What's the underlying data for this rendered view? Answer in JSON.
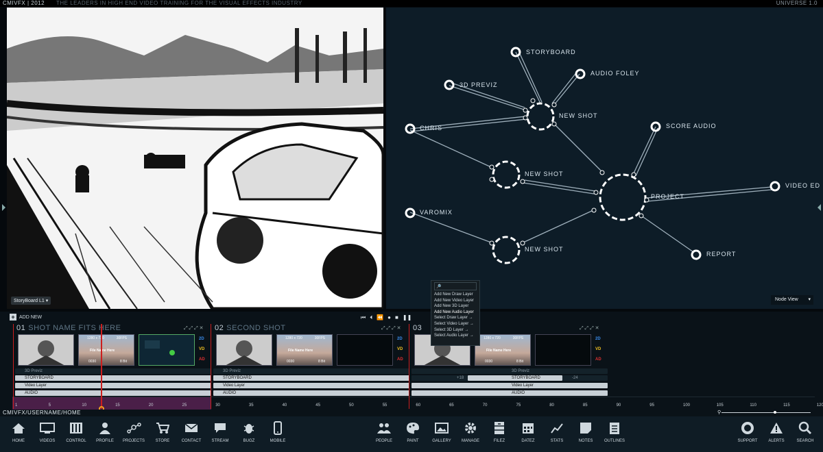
{
  "topbar": {
    "brand": "CMIVFX | 2012",
    "tagline": "THE LEADERS IN HIGH END VIDEO TRAINING FOR THE VISUAL EFFECTS INDUSTRY",
    "version": "UNIVERSE 1.0"
  },
  "viewer": {
    "label": "StoryBoard L1"
  },
  "nodeview": {
    "mode_label": "Node View",
    "nodes": [
      {
        "label": "STORYBOARD"
      },
      {
        "label": "AUDIO FOLEY"
      },
      {
        "label": "3D PREVIZ"
      },
      {
        "label": "NEW SHOT"
      },
      {
        "label": "CHRIS"
      },
      {
        "label": "SCORE AUDIO"
      },
      {
        "label": "NEW SHOT"
      },
      {
        "label": "PROJECT"
      },
      {
        "label": "VIDEO ED"
      },
      {
        "label": "VAROMIX"
      },
      {
        "label": "NEW SHOT"
      },
      {
        "label": "REPORT"
      }
    ]
  },
  "timeline": {
    "add_new": "ADD NEW",
    "shots": [
      {
        "num": "01",
        "name": "SHOT NAME FITS HERE"
      },
      {
        "num": "02",
        "name": "SECOND SHOT"
      },
      {
        "num": "03",
        "name": ""
      }
    ],
    "clip_info": {
      "res": "1280 x 720",
      "fps": "30FPS",
      "name": "File Name Here",
      "frame": "0030",
      "bits": "8 Bit"
    },
    "tags": [
      "2D",
      "VD",
      "AD"
    ],
    "layers": [
      "3D Previz",
      "STORYBOARD",
      "Video Layer",
      "AUDIO"
    ],
    "offsets": [
      "+18",
      "-24"
    ],
    "ruler": [
      "1",
      "5",
      "10",
      "15",
      "20",
      "25",
      "30",
      "35",
      "40",
      "45",
      "50",
      "55",
      "60",
      "65",
      "70",
      "75",
      "80",
      "85",
      "90",
      "95",
      "100",
      "105",
      "110",
      "115",
      "120"
    ]
  },
  "context_menu": {
    "items": [
      "Add New Draw Layer",
      "Add New Video Layer",
      "Add New 3D Layer",
      "Add New Audio Layer",
      "Select Draw Layer →",
      "Select Video Layer →",
      "Select 3D Layer →",
      "Select Audio Layer →"
    ]
  },
  "path": "CMIVFX/USERNAME/HOME",
  "nav_left": [
    "HOME",
    "VIDEOS",
    "CONTROL",
    "PROFILE",
    "PROJECTS",
    "STORE",
    "CONTACT",
    "STREAM",
    "BUGZ",
    "MOBILE"
  ],
  "nav_mid": [
    "PEOPLE",
    "PAINT",
    "GALLERY",
    "MANAGE",
    "FILEZ",
    "DATEZ",
    "STATS",
    "NOTES",
    "OUTLINES"
  ],
  "nav_right": [
    "SUPPORT",
    "ALERTS",
    "SEARCH"
  ],
  "colors": {
    "accent": "#4a1f48",
    "playhead": "#cc1e1e",
    "marker": "#f0a020",
    "node_bg": "#0d1c27"
  }
}
